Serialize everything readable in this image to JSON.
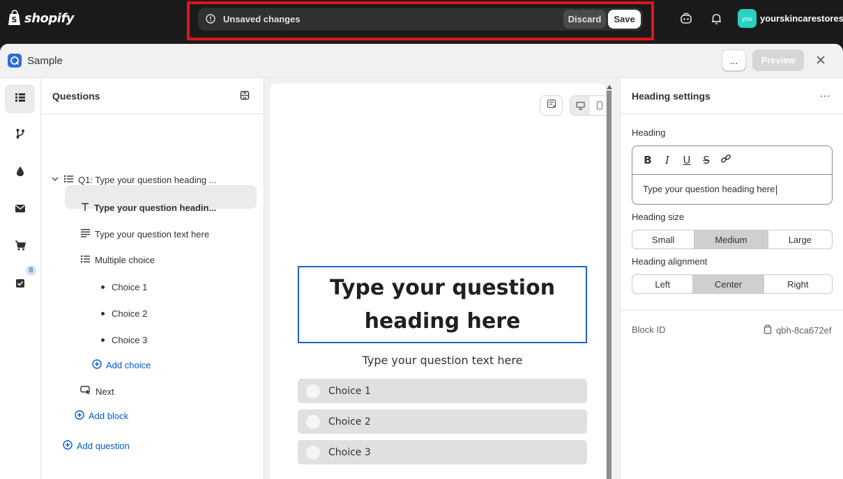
{
  "topbar": {
    "logo_text": "shopify",
    "unsaved_text": "Unsaved changes",
    "discard_label": "Discard",
    "save_label": "Save",
    "avatar_text": "you",
    "store_name": "yourskincarestores"
  },
  "modal": {
    "title": "Sample",
    "more_label": "...",
    "preview_label": "Preview"
  },
  "rail": {
    "badge_count": "8"
  },
  "questions": {
    "title": "Questions",
    "q1_label": "Q1: Type your question heading ...",
    "heading_item": "Type your question headin...",
    "text_item": "Type your question text here",
    "multiple_choice": "Multiple choice",
    "choices": [
      "Choice 1",
      "Choice 2",
      "Choice 3"
    ],
    "add_choice": "Add choice",
    "next_label": "Next",
    "add_block": "Add block",
    "add_question": "Add question"
  },
  "canvas": {
    "heading": "Type your question heading here",
    "text": "Type your question text here",
    "choices": [
      "Choice 1",
      "Choice 2",
      "Choice 3"
    ]
  },
  "settings": {
    "title": "Heading settings",
    "more": "…",
    "heading_label": "Heading",
    "heading_value": "Type your question heading here",
    "size_label": "Heading size",
    "sizes": [
      "Small",
      "Medium",
      "Large"
    ],
    "selected_size": "Medium",
    "alignment_label": "Heading alignment",
    "alignments": [
      "Left",
      "Center",
      "Right"
    ],
    "selected_alignment": "Center",
    "block_id_label": "Block ID",
    "block_id_value": "qbh-8ca672ef"
  }
}
